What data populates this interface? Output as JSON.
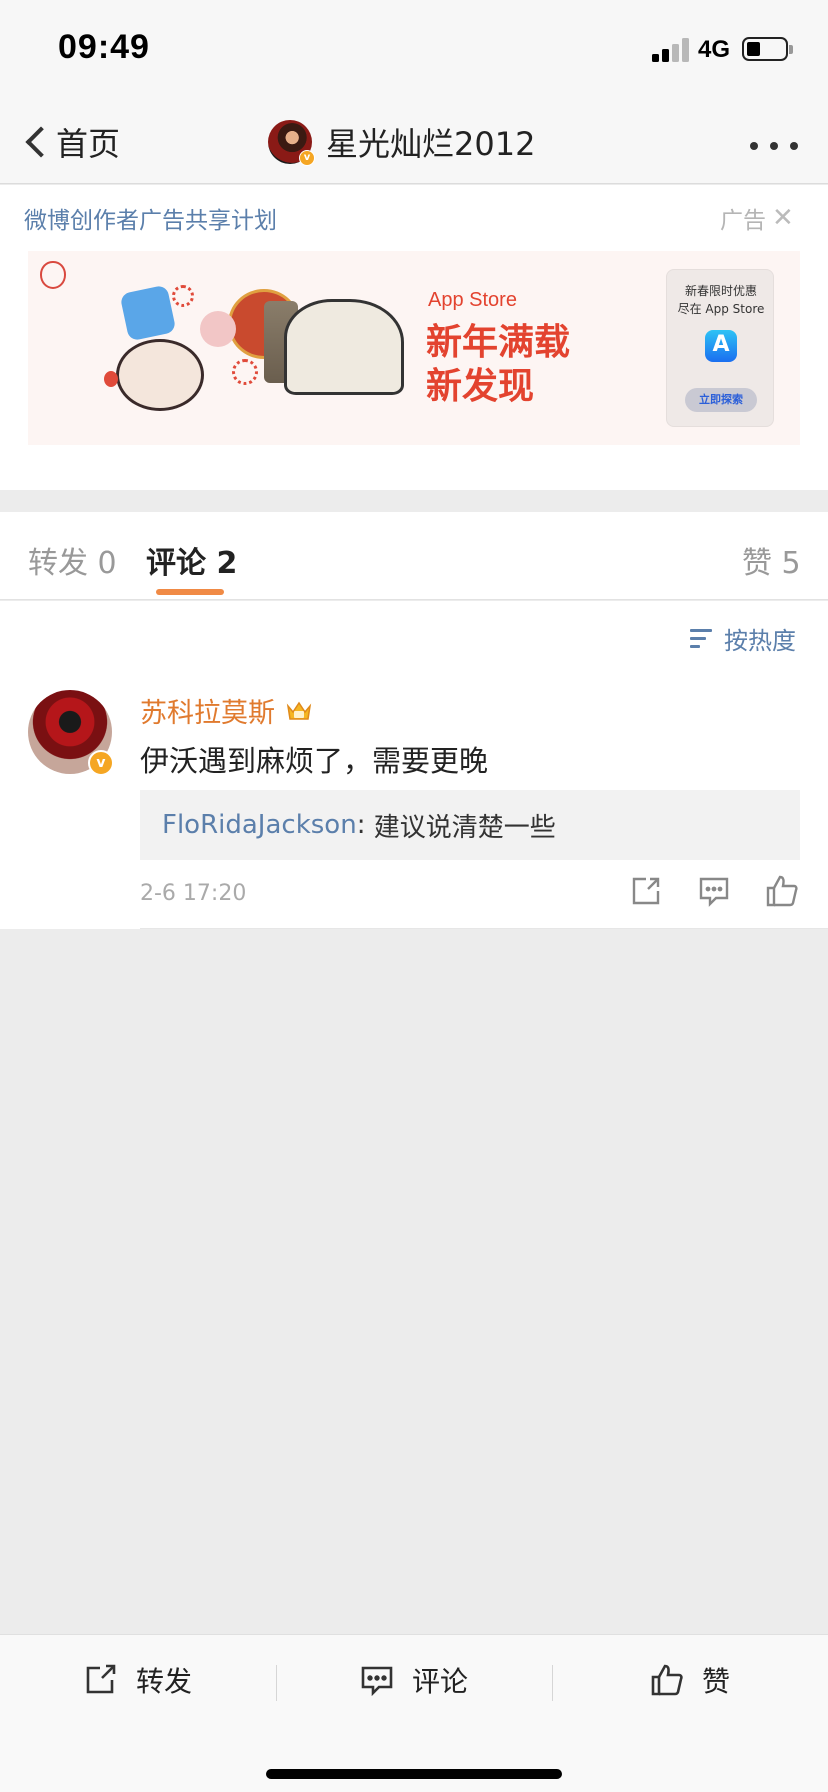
{
  "status_bar": {
    "time": "09:49",
    "network": "4G",
    "battery_level_pct": 35
  },
  "nav": {
    "back_label": "首页",
    "title": "星光灿烂2012",
    "more_icon": "ellipsis-icon"
  },
  "ad": {
    "program_label": "微博创作者广告共享计划",
    "ad_tag": "广告",
    "close_icon": "close-icon",
    "banner": {
      "brand": "App Store",
      "headline_line1": "新年满载",
      "headline_line2": "新发现",
      "card_line1": "新春限时优惠",
      "card_line2": "尽在 App Store",
      "card_button": "立即探索"
    }
  },
  "tabs": {
    "repost": "转发 0",
    "comment": "评论 2",
    "like": "赞 5",
    "active": "comment",
    "accent": "#f08a45"
  },
  "sort": {
    "label": "按热度",
    "icon": "sort-icon"
  },
  "comments": [
    {
      "author": "苏科拉莫斯",
      "verified": true,
      "badge_icon": "crown-icon",
      "text": "伊沃遇到麻烦了，需要更晚",
      "reply": {
        "user": "FloRidaJackson",
        "separator": ": ",
        "text": "建议说清楚一些"
      },
      "time": "2-6 17:20",
      "actions": [
        "share-icon",
        "comment-icon",
        "like-icon"
      ]
    }
  ],
  "bottom_bar": {
    "repost_label": "转发",
    "comment_label": "评论",
    "like_label": "赞"
  },
  "colors": {
    "link_blue": "#5b7fab",
    "author_orange": "#e07a2e",
    "ad_red": "#e3432f",
    "verified_gold": "#f5a623"
  }
}
